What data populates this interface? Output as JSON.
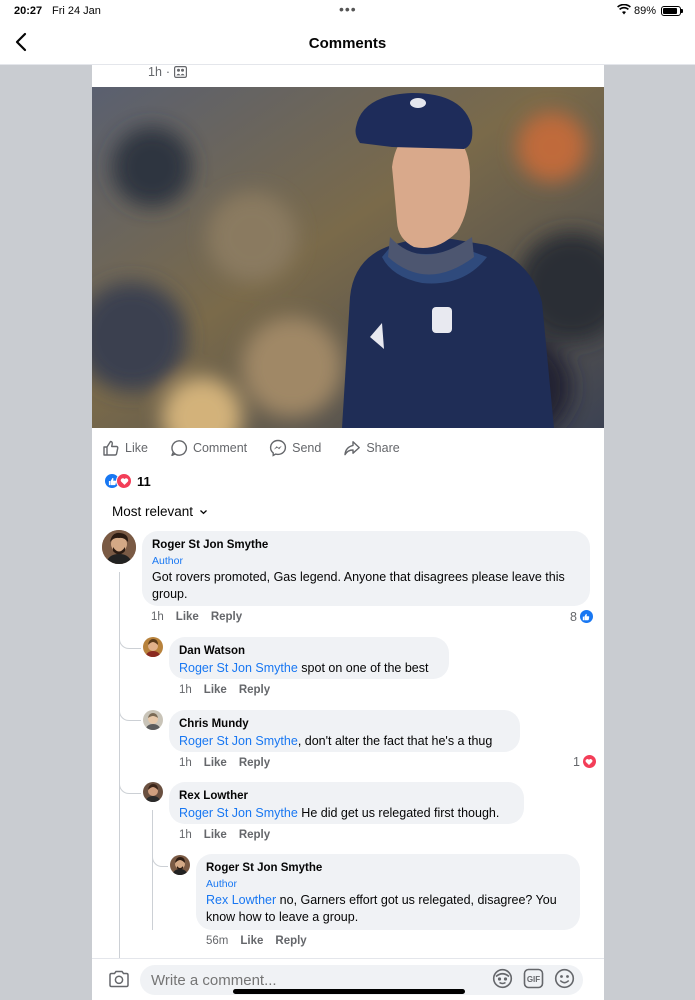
{
  "status": {
    "time": "20:27",
    "date": "Fri 24 Jan",
    "battery": "89%",
    "battery_level": 0.89
  },
  "header": {
    "title": "Comments"
  },
  "post": {
    "time": "1h",
    "audience_icon": "group-icon"
  },
  "actions": {
    "like": "Like",
    "comment": "Comment",
    "send": "Send",
    "share": "Share"
  },
  "reactions": {
    "count": "11",
    "types": [
      "like",
      "love"
    ]
  },
  "sort": {
    "label": "Most relevant"
  },
  "comments": [
    {
      "author": "Roger St Jon Smythe",
      "badge": "Author",
      "mention": "",
      "text": "Got rovers promoted, Gas legend. Anyone that disagrees please leave this group.",
      "time": "1h",
      "like": "Like",
      "reply": "Reply",
      "reaction_count": "8",
      "reaction": "like"
    },
    {
      "author": "Dan Watson",
      "mention": "Roger St Jon Smythe",
      "text": " spot on one of the best",
      "time": "1h",
      "like": "Like",
      "reply": "Reply"
    },
    {
      "author": "Chris Mundy",
      "mention": "Roger St Jon Smythe",
      "text": ", don't alter the fact that he's a thug",
      "time": "1h",
      "like": "Like",
      "reply": "Reply",
      "reaction_count": "1",
      "reaction": "love"
    },
    {
      "author": "Rex Lowther",
      "mention": "Roger St Jon Smythe",
      "text": " He did get us relegated first though.",
      "time": "1h",
      "like": "Like",
      "reply": "Reply"
    },
    {
      "author": "Roger St Jon Smythe",
      "badge": "Author",
      "mention": "Rex Lowther",
      "text": " no, Garners effort got us relegated, disagree? You know how to leave a group.",
      "time": "56m",
      "like": "Like",
      "reply": "Reply"
    }
  ],
  "composer": {
    "placeholder": "Write a comment..."
  },
  "colors": {
    "accent": "#1877f2",
    "love": "#f33e58",
    "bubble": "#f0f2f5",
    "backdrop": "#c9ccd1"
  }
}
